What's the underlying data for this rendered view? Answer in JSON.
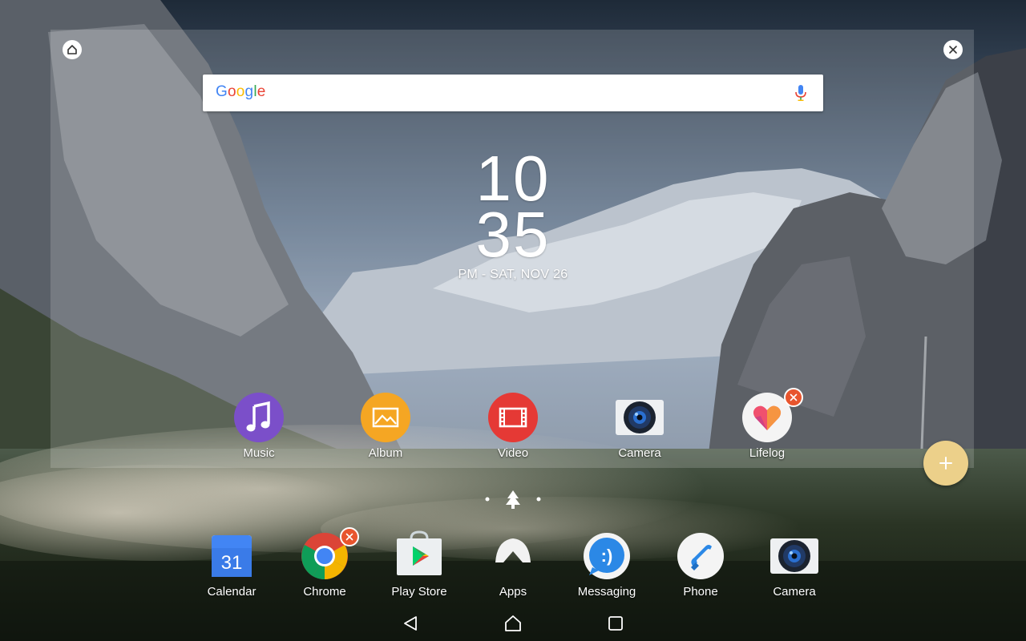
{
  "clock": {
    "hour": "10",
    "minute": "35",
    "date_line": "PM - SAT, NOV 26"
  },
  "search": {
    "logo_letters": [
      "G",
      "o",
      "o",
      "g",
      "l",
      "e"
    ],
    "logo_colors": [
      "#4285F4",
      "#EA4335",
      "#FBBC05",
      "#4285F4",
      "#34A853",
      "#EA4335"
    ]
  },
  "panel_apps": [
    {
      "label": "Music",
      "icon": "music-icon"
    },
    {
      "label": "Album",
      "icon": "album-icon"
    },
    {
      "label": "Video",
      "icon": "video-icon"
    },
    {
      "label": "Camera",
      "icon": "camera-icon"
    },
    {
      "label": "Lifelog",
      "icon": "lifelog-icon",
      "removable": true
    }
  ],
  "dock_apps": [
    {
      "label": "Calendar",
      "icon": "calendar-icon",
      "icon_text": "31"
    },
    {
      "label": "Chrome",
      "icon": "chrome-icon",
      "removable": true
    },
    {
      "label": "Play Store",
      "icon": "play-store-icon"
    },
    {
      "label": "Apps",
      "icon": "apps-drawer-icon"
    },
    {
      "label": "Messaging",
      "icon": "messaging-icon",
      "icon_text": ":)"
    },
    {
      "label": "Phone",
      "icon": "phone-icon"
    },
    {
      "label": "Camera",
      "icon": "camera-icon"
    }
  ],
  "colors": {
    "fab": "#ecd08a",
    "remove_badge": "#e8552e",
    "music": "#7b4fc9",
    "album": "#f5a623",
    "video": "#e53935"
  }
}
